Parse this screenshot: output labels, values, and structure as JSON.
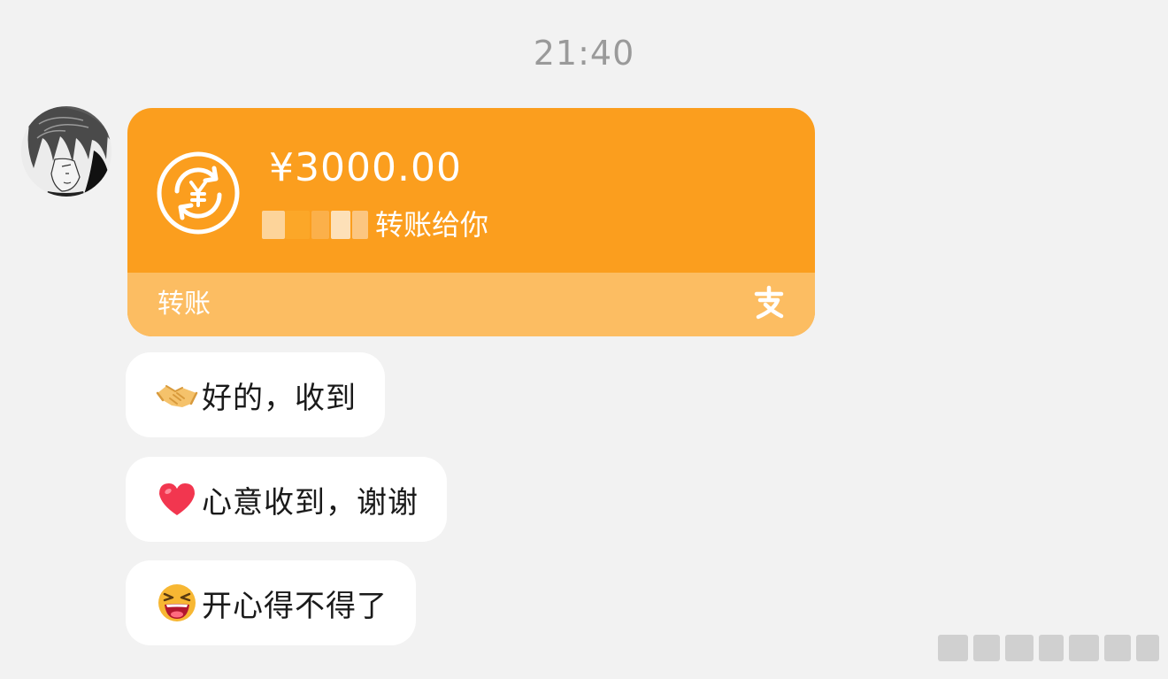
{
  "timestamp": "21:40",
  "transfer": {
    "amount": "¥3000.00",
    "sender_text": "转账给你",
    "card_type_label": "转账",
    "card_color": "#fb9e1e",
    "card_footer_color": "#fcbd62",
    "coin_icon": "yuan-transfer-icon",
    "brand_icon": "alipay-icon"
  },
  "messages": [
    {
      "emoji": "handshake-emoji",
      "text": "好的，收到"
    },
    {
      "emoji": "heart-emoji",
      "text": "心意收到，谢谢"
    },
    {
      "emoji": "laughing-face-emoji",
      "text": "开心得不得了"
    }
  ],
  "colors": {
    "background": "#f2f2f2",
    "bubble": "#ffffff",
    "timestamp": "#9a9a9a"
  }
}
